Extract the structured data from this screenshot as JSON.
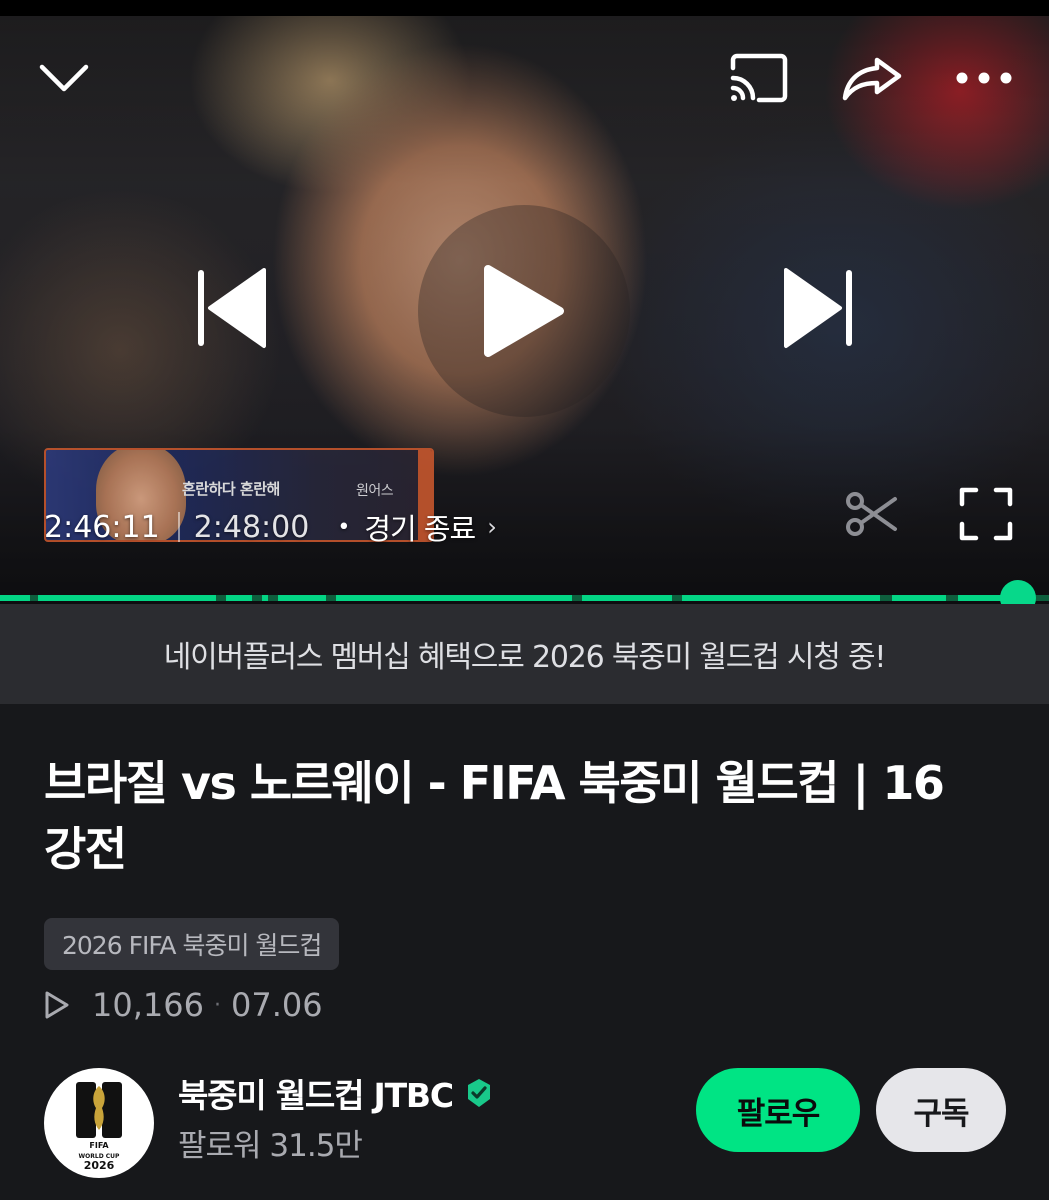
{
  "player": {
    "current_time": "2:46:11",
    "total_time": "2:48:00",
    "status_link": "경기 종료",
    "preview_caption": "혼란하다 혼란해",
    "preview_caption_right": "원어스",
    "progress_fraction": 0.97,
    "progress_color": "#03d584",
    "icons": {
      "collapse": "chevron-down-icon",
      "cast": "cast-icon",
      "share": "share-icon",
      "more": "more-horizontal-icon",
      "prev": "skip-previous-icon",
      "play": "play-icon",
      "next": "skip-next-icon",
      "clip": "scissors-icon",
      "fullscreen": "fullscreen-icon"
    }
  },
  "banner": {
    "text": "네이버플러스 멤버십 혜택으로 2026 북중미 월드컵 시청 중!"
  },
  "video": {
    "title": "브라질 vs 노르웨이 - FIFA 북중미 월드컵 | 16강전",
    "tag": "2026 FIFA 북중미 월드컵",
    "views": "10,166",
    "date": "07.06"
  },
  "channel": {
    "name": "북중미 월드컵 JTBC",
    "followers": "팔로워 31.5만",
    "follow_label": "팔로우",
    "subscribe_label": "구독",
    "accent": "#00e484",
    "logo_text": "FIFA",
    "logo_subtext": "WORLD CUP",
    "logo_year": "2026"
  }
}
